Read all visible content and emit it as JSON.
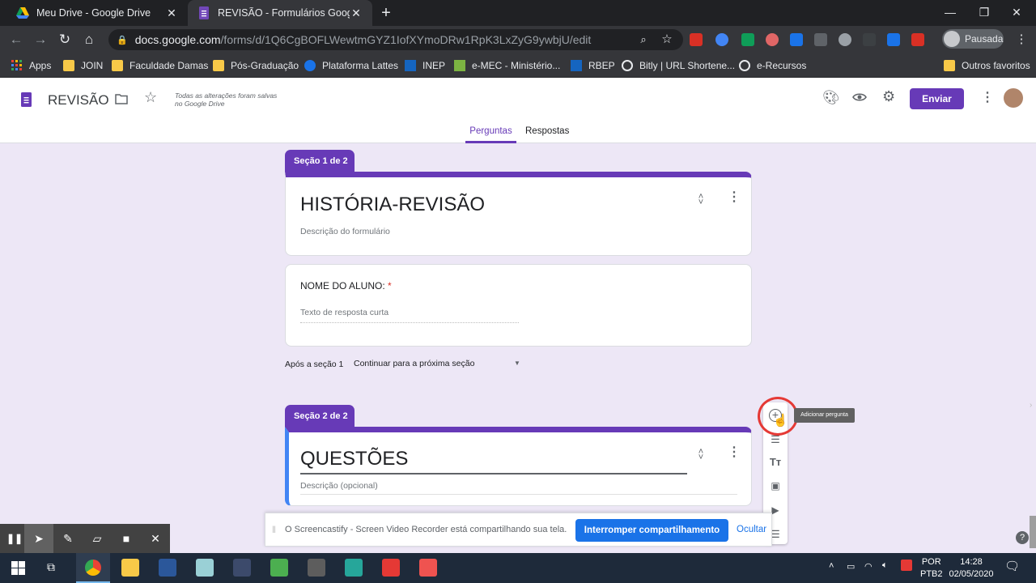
{
  "browser": {
    "tabs": [
      {
        "title": "Meu Drive - Google Drive",
        "active": false
      },
      {
        "title": "REVISÃO - Formulários Google",
        "active": true
      }
    ],
    "url_host": "docs.google.com",
    "url_path": "/forms/d/1Q6CgBOFLWewtmGYZ1IofXYmoDRw1RpK3LxZyG9ywbjU/edit",
    "profile_label": "Pausada",
    "bookmarks": [
      "Apps",
      "JOIN",
      "Faculdade Damas",
      "Pós-Graduação",
      "Plataforma Lattes",
      "INEP",
      "e-MEC - Ministério...",
      "RBEP",
      "Bitly | URL Shortene...",
      "e-Recursos"
    ],
    "other_bookmarks": "Outros favoritos"
  },
  "forms": {
    "doc_title": "REVISÃO",
    "saved_note": "Todas as alterações foram salvas no Google Drive",
    "send_label": "Enviar",
    "tabs": [
      "Perguntas",
      "Respostas"
    ],
    "active_tab": "Perguntas"
  },
  "section1": {
    "tag": "Seção 1 de 2",
    "title": "HISTÓRIA-REVISÃO",
    "description": "Descrição do formulário",
    "question": {
      "label": "NOME DO ALUNO:",
      "required_mark": "*",
      "placeholder": "Texto de resposta curta"
    },
    "after_label": "Após a seção 1",
    "after_value": "Continuar para a próxima seção"
  },
  "section2": {
    "tag": "Seção 2 de 2",
    "title": "QUESTÕES",
    "description": "Descrição (opcional)"
  },
  "side_toolbar": {
    "tooltip": "Adicionar pergunta",
    "icons": [
      "add-question-icon",
      "import-questions-icon",
      "add-title-icon",
      "add-image-icon",
      "add-video-icon",
      "add-section-icon"
    ]
  },
  "share_bar": {
    "text": "O Screencastify - Screen Video Recorder está compartilhando sua tela.",
    "stop_label": "Interromper compartilhamento",
    "hide_label": "Ocultar"
  },
  "taskbar": {
    "lang": "POR",
    "layout": "PTB2",
    "time": "14:28",
    "date": "02/05/2020"
  },
  "colors": {
    "accent": "#673ab7",
    "background": "#ede7f6",
    "share_button": "#1a73e8"
  }
}
